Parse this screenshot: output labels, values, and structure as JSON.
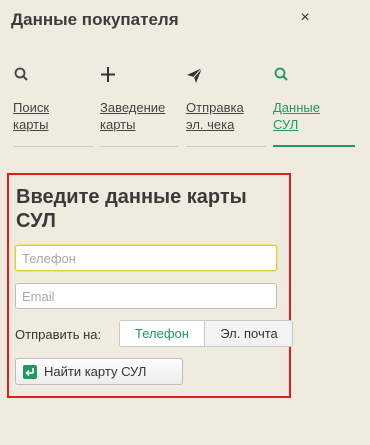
{
  "header": {
    "title": "Данные покупателя",
    "close_glyph": "×"
  },
  "tabs": [
    {
      "label": "Поиск карты",
      "icon": "search-icon"
    },
    {
      "label": "Заведение карты",
      "icon": "plus-icon"
    },
    {
      "label": "Отправка эл. чека",
      "icon": "send-icon"
    },
    {
      "label": "Данные СУЛ",
      "icon": "search-icon",
      "active": true
    }
  ],
  "form": {
    "heading": "Введите данные карты СУЛ",
    "phone_placeholder": "Телефон",
    "email_placeholder": "Email",
    "send_to_label": "Отправить на:",
    "send_options": [
      "Телефон",
      "Эл. почта"
    ],
    "send_selected": "Телефон",
    "find_button_label": "Найти карту СУЛ"
  },
  "colors": {
    "accent": "#1e9a62",
    "highlight_border": "#e31c1c",
    "background": "#efebde"
  }
}
